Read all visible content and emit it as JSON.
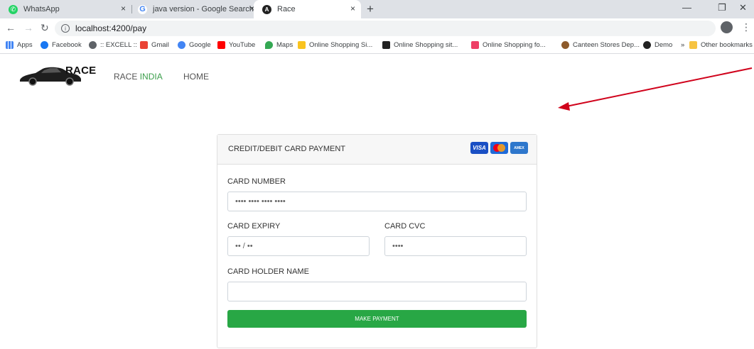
{
  "browser": {
    "tabs": [
      {
        "title": "WhatsApp"
      },
      {
        "title": "java version - Google Search"
      },
      {
        "title": "Race"
      }
    ],
    "new_tab": "+",
    "close_glyph": "×",
    "url": "localhost:4200/pay",
    "window_controls": {
      "minimize": "—",
      "restore": "❐",
      "close": "✕"
    }
  },
  "bookmarks": {
    "items": [
      {
        "label": "Apps",
        "color": "#4285f4"
      },
      {
        "label": "Facebook",
        "color": "#1877f2"
      },
      {
        "label": ":: EXCELL ::",
        "color": "#5f6368"
      },
      {
        "label": "Gmail",
        "color": "#ea4335"
      },
      {
        "label": "Google",
        "color": "#4285f4"
      },
      {
        "label": "YouTube",
        "color": "#ff0000"
      },
      {
        "label": "Maps",
        "color": "#34a853"
      },
      {
        "label": "Online Shopping Si...",
        "color": "#f9c31f"
      },
      {
        "label": "Online Shopping sit...",
        "color": "#222222"
      },
      {
        "label": "Online Shopping fo...",
        "color": "#ee3f66"
      },
      {
        "label": "Canteen Stores Dep...",
        "color": "#8d5a2b"
      },
      {
        "label": "Demo",
        "color": "#222222"
      }
    ],
    "overflow": "»",
    "other": "Other bookmarks"
  },
  "site": {
    "logo_text": "RACE",
    "nav": {
      "brand_prefix": "RACE ",
      "brand_accent": "INDIA",
      "home": "HOME"
    },
    "accent_color": "#3a9e4a"
  },
  "payment": {
    "header": "CREDIT/DEBIT CARD PAYMENT",
    "card_brands": {
      "visa": "VISA",
      "amex": "AMEX"
    },
    "card_number_label": "CARD NUMBER",
    "card_number_placeholder": "•••• •••• •••• ••••",
    "card_expiry_label": "CARD EXPIRY",
    "card_expiry_placeholder": "•• / ••",
    "card_cvc_label": "CARD CVC",
    "card_cvc_placeholder": "••••",
    "holder_label": "CARD HOLDER NAME",
    "holder_value": "",
    "submit_label": "MAKE PAYMENT",
    "submit_color": "#28a745"
  },
  "annotation": {
    "arrow_color": "#d0021b"
  }
}
